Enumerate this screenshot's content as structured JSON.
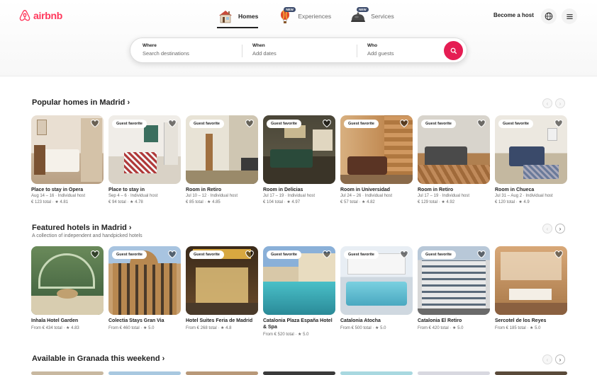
{
  "brand": {
    "name": "airbnb",
    "color": "#ff385c"
  },
  "nav": {
    "tabs": [
      {
        "label": "Homes",
        "active": true,
        "icon": "house-icon"
      },
      {
        "label": "Experiences",
        "active": false,
        "badge": "NEW",
        "icon": "hot-air-balloon-icon"
      },
      {
        "label": "Services",
        "active": false,
        "badge": "NEW",
        "icon": "service-bell-icon"
      }
    ],
    "host_link": "Become a host",
    "globe_icon": "globe-icon",
    "menu_icon": "hamburger-menu-icon"
  },
  "search": {
    "where_label": "Where",
    "where_placeholder": "Search destinations",
    "when_label": "When",
    "when_placeholder": "Add dates",
    "who_label": "Who",
    "who_placeholder": "Add guests",
    "button_color": "#e51d53"
  },
  "sections": [
    {
      "title": "Popular homes in Madrid",
      "arrow": "›",
      "prev": "‹",
      "next": "›",
      "cards": [
        {
          "title": "Place to stay in Opera",
          "dates": "Aug 14 – 16 · Individual host",
          "price": "€ 123 total · ★ 4.81",
          "badge": ""
        },
        {
          "title": "Place to stay in",
          "dates": "Sep 4 – 6 · Individual host",
          "price": "€ 94 total · ★ 4.78",
          "badge": "Guest favorite"
        },
        {
          "title": "Room in Retiro",
          "dates": "Jul 10 – 12 · Individual host",
          "price": "€ 85 total · ★ 4.85",
          "badge": "Guest favorite"
        },
        {
          "title": "Room in Delicias",
          "dates": "Jul 17 – 19 · Individual host",
          "price": "€ 104 total · ★ 4.97",
          "badge": "Guest favorite"
        },
        {
          "title": "Room in Universidad",
          "dates": "Jul 24 – 26 · Individual host",
          "price": "€ 57 total · ★ 4.82",
          "badge": "Guest favorite"
        },
        {
          "title": "Room in Retiro",
          "dates": "Jul 17 – 19 · Individual host",
          "price": "€ 129 total · ★ 4.92",
          "badge": "Guest favorite"
        },
        {
          "title": "Room in Chueca",
          "dates": "Jul 31 – Aug 2 · Individual host",
          "price": "€ 120 total · ★ 4.9",
          "badge": "Guest favorite"
        }
      ]
    },
    {
      "title": "Featured hotels in Madrid",
      "arrow": "›",
      "subtitle": "A collection of independent and handpicked hotels",
      "prev": "‹",
      "next": "›",
      "cards": [
        {
          "title": "Inhala Hotel Garden",
          "price": "From € 434 total · ★ 4.83",
          "badge": ""
        },
        {
          "title": "Colectia Stays Gran Via",
          "price": "From € 460 total · ★ 5.0",
          "badge": "Guest favorite"
        },
        {
          "title": "Hotel Suites Feria de Madrid",
          "price": "From € 268 total · ★ 4.8",
          "badge": "Guest favorite"
        },
        {
          "title": "Catalonia Plaza España Hotel & Spa",
          "price": "From € 520 total · ★ 5.0",
          "badge": "Guest favorite"
        },
        {
          "title": "Catalonia Atocha",
          "price": "From € 500 total · ★ 5.0",
          "badge": "Guest favorite"
        },
        {
          "title": "Catalonia El Retiro",
          "price": "From € 420 total · ★ 5.0",
          "badge": "Guest favorite"
        },
        {
          "title": "Sercotel de los Reyes",
          "price": "From € 185 total · ★ 5.0",
          "badge": ""
        }
      ]
    },
    {
      "title": "Available in Granada this weekend",
      "arrow": "›",
      "prev": "‹",
      "next": "›"
    }
  ]
}
